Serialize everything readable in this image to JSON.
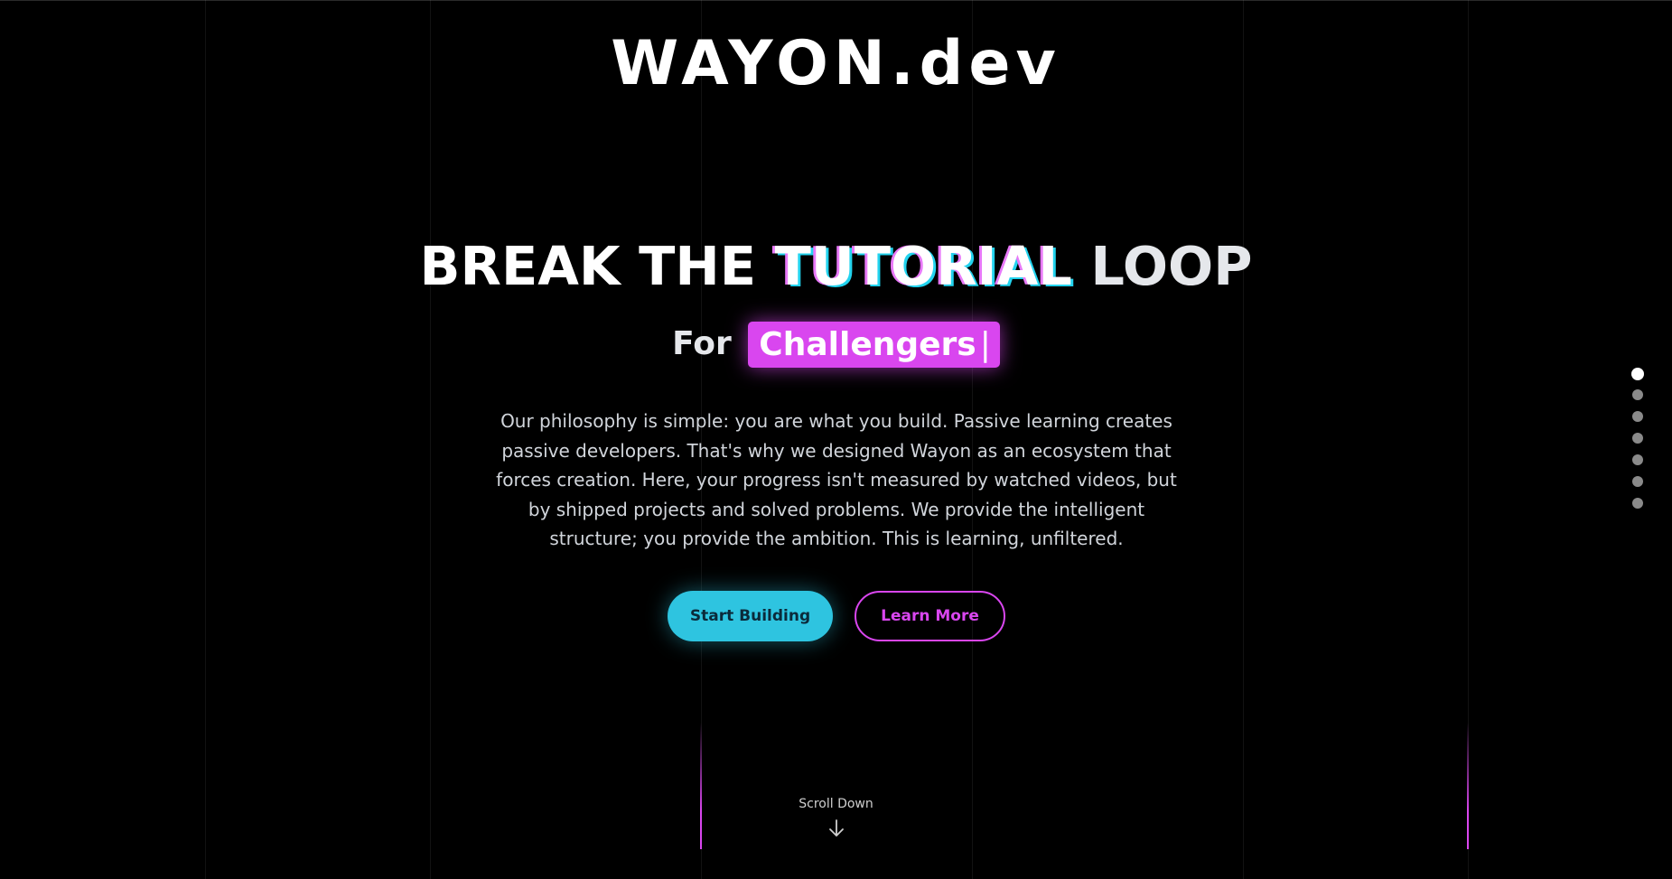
{
  "brand": {
    "logo_text": "WAYON.dev"
  },
  "hero": {
    "headline_part1": "BREAK THE",
    "headline_highlight": "TUTORIAL",
    "headline_part2": "LOOP",
    "sub_prefix": "For",
    "sub_highlight": "Challengers",
    "cursor": "|",
    "philosophy": "Our philosophy is simple: you are what you build. Passive learning creates passive developers. That's why we designed Wayon as an ecosystem that forces creation. Here, your progress isn't measured by watched videos, but by shipped projects and solved problems. We provide the intelligent structure; you provide the ambition. This is learning, unfiltered."
  },
  "actions": {
    "primary_label": "Start Building",
    "secondary_label": "Learn More"
  },
  "scroll": {
    "label": "Scroll Down",
    "icon": "arrow-down-icon"
  },
  "section_nav": {
    "count": 7,
    "active_index": 0
  },
  "colors": {
    "background": "#000000",
    "cyan_accent": "#2ec4e0",
    "magenta_accent": "#d946ef",
    "body_text": "#d1d5db"
  }
}
